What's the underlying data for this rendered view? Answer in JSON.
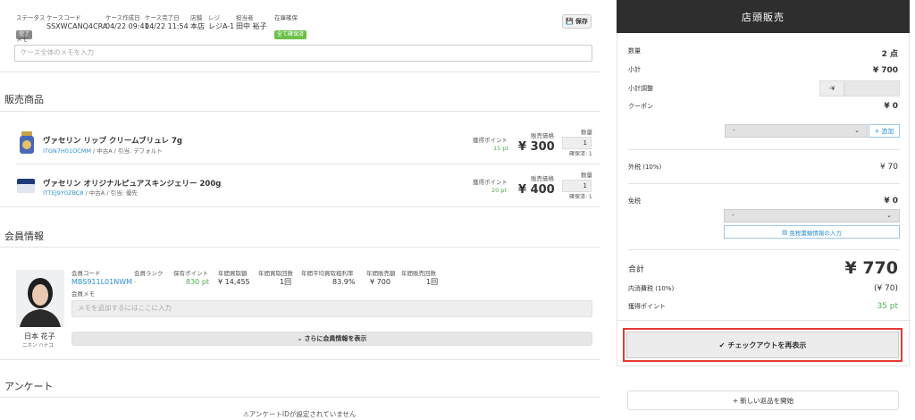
{
  "case": {
    "status_label": "ステータス",
    "status_value": "完了",
    "code_label": "ケースコード",
    "code_value": "SSXWCANQ4CRA",
    "created_label": "ケース作成日",
    "created_value": "04/22 09:41",
    "completed_label": "ケース完了日",
    "completed_value": "04/22 11:54",
    "store_label": "店舗",
    "store_value": "本店",
    "register_label": "レジ",
    "register_value": "レジA-1",
    "staff_label": "担当者",
    "staff_value": "田中 裕子",
    "stock_label": "在庫確保",
    "stock_value": "全て確保済",
    "save_label": "保存",
    "memo_label": "メモ",
    "memo_placeholder": "ケース全体のメモを入力"
  },
  "products": {
    "title": "販売商品",
    "items": [
      {
        "name": "ヴァセリン リップ クリームブリュレ 7g",
        "code": "ITGN7H01OCMM",
        "meta": " / 中古A / 引当: デフォルト",
        "points_label": "獲得ポイント",
        "points": "15 pt",
        "price_label": "販売価格",
        "price": "¥ 300",
        "qty_label": "数量",
        "qty": "1",
        "reserved": "確保済: 1"
      },
      {
        "name": "ヴァセリン オリジナルピュアスキンジェリー 200g",
        "code": "ITTEJ9Y0ZBC8",
        "meta": " / 中古A / 引当: 優先",
        "points_label": "獲得ポイント",
        "points": "20 pt",
        "price_label": "販売価格",
        "price": "¥ 400",
        "qty_label": "数量",
        "qty": "1",
        "reserved": "確保済: 1"
      }
    ]
  },
  "member": {
    "title": "会員情報",
    "name": "日本 花子",
    "kana": "ニホン ハナコ",
    "code_label": "会員コード",
    "code": "MBS911L01NWM",
    "rank_label": "会員ランク",
    "rank": "-",
    "points_label": "保有ポイント",
    "points": "830 pt",
    "buy_amt_label": "年間買取額",
    "buy_amt": "¥ 14,455",
    "buy_cnt_label": "年間買取回数",
    "buy_cnt": "1回",
    "margin_label": "年間平均買取粗利率",
    "margin": "83.9%",
    "sales_amt_label": "年間販売額",
    "sales_amt": "¥ 700",
    "sales_cnt_label": "年間販売回数",
    "sales_cnt": "1回",
    "memo_label": "会員メモ",
    "memo_placeholder": "メモを追加するにはここに入力",
    "more_label": "さらに会員情報を表示"
  },
  "survey": {
    "title": "アンケート",
    "notice": "アンケートIDが設定されていません"
  },
  "panel": {
    "title": "店頭販売",
    "qty_label": "数量",
    "qty": "2 点",
    "subtotal_label": "小計",
    "subtotal": "¥ 700",
    "adjust_label": "小計調整",
    "adjust_prefix": "-¥",
    "coupon_label": "クーポン",
    "coupon": "¥ 0",
    "coupon_select": "-",
    "add_label": "+ 追加",
    "tax_ex_label": "外税 (10%)",
    "tax_ex": "¥ 70",
    "tax_free_label": "免税",
    "tax_free": "¥ 0",
    "tax_free_select": "-",
    "tax_free_btn": "免税書類情報の入力",
    "total_label": "合計",
    "total": "¥ 770",
    "tax_in_label": "内消費税 (10%)",
    "tax_in": "(¥ 70)",
    "earn_label": "獲得ポイント",
    "earn": "35 pt",
    "checkout_label": "チェックアウトを再表示",
    "new_return_label": "新しい返品を開始"
  },
  "colors": {
    "dark": "#2e2e2e",
    "green": "#4caf50",
    "link": "#2b8fd6",
    "red": "#e53935"
  }
}
